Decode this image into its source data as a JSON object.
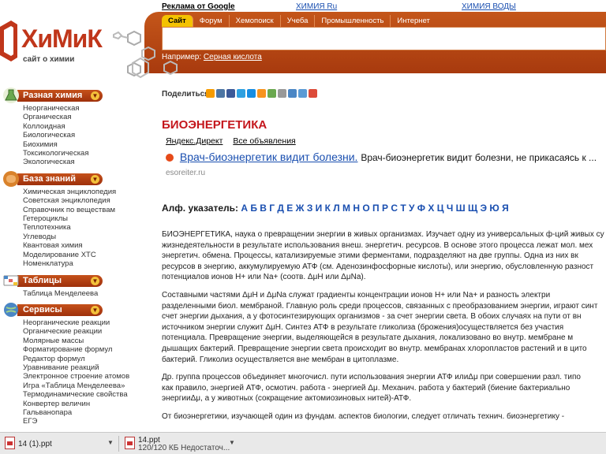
{
  "logo": {
    "name": "ХиМиК",
    "subtitle": "сайт о химии"
  },
  "ads_top": {
    "google": "Реклама от Google",
    "link1": "ХИМИЯ Ru",
    "link2": "ХИМИЯ ВОДЫ"
  },
  "nav": {
    "tabs": [
      "Сайт",
      "Форум",
      "Хемопоиск",
      "Учеба",
      "Промышленность",
      "Интернет"
    ],
    "search_value": "",
    "example_label": "Например:",
    "example_link": "Серная кислота"
  },
  "sidebar": {
    "sections": [
      {
        "title": "Разная химия",
        "icon": "flask-icon",
        "items": [
          "Неорганическая",
          "Органическая",
          "Коллоидная",
          "Биологическая",
          "Биохимия",
          "Токсикологическая",
          "Экологическая"
        ]
      },
      {
        "title": "База знаний",
        "icon": "brain-icon",
        "items": [
          "Химическая энциклопедия",
          "Советская энциклопедия",
          "Справочник по веществам",
          "Гетероциклы",
          "Теплотехника",
          "Углеводы",
          "Квантовая химия",
          "Моделирование ХТС",
          "Номенклатура"
        ]
      },
      {
        "title": "Таблицы",
        "icon": "table-icon",
        "items": [
          "Таблица Менделеева"
        ]
      },
      {
        "title": "Сервисы",
        "icon": "globe-icon",
        "items": [
          "Неорганические реакции",
          "Органические реакции",
          "Молярные массы",
          "Форматирование формул",
          "Редактор формул",
          "Уравнивание реакций",
          "Электронное строение атомов",
          "Игра «Таблица Менделеева»",
          "Термодинамические свойства",
          "Конвертер величин",
          "Гальванопара",
          "ЕГЭ"
        ]
      }
    ]
  },
  "main": {
    "share_label": "Поделиться:",
    "title": "БИОЭНЕРГЕТИКА",
    "yad": {
      "direct": "Яндекс.Директ",
      "all": "Все объявления"
    },
    "ad": {
      "title": "Врач-биоэнергетик видит болезни.",
      "desc": "Врач-биоэнергетик видит болезни, не прикасаясь к ...",
      "domain": "esoreiter.ru"
    },
    "alphabet_label": "Алф. указатель:",
    "alphabet": "А Б В Г Д Е Ж З И К Л М Н О П Р С Т У Ф Х Ц Ч Ш Щ Э Ю Я",
    "paragraphs": [
      "БИОЭНЕРГЕТИКА, наука о превращении энергии в живых организмах. Изучает одну из универсальных ф-ций живых су",
      "жизнедеятельности в результате использования внеш. энергетич. ресурсов. В основе этого процесса лежат мол. мех",
      "энергетич. обмена. Процессы, катализируемые этими ферментами, подразделяют на две группы. Одна из них вк",
      "ресурсов в энергию, аккумулируемую АТФ (см. Аденозинфосфорные кислоты), или энергию, обусловленную разност",
      "потенциалов ионов H+ или Na+ (соотв. ΔμH или ΔμNa).",
      "Составными частями ΔμH и ΔμNa служат градиенты концентрации ионов H+ или Na+ и разность электри",
      "разделенными биол. мембраной. Главную роль среди процессов, связанных с преобразованием энергии, играют синт",
      "счет энергии дыхания, а у фотосинтезирующих организмов - за счет энергии света. В обоих случаях на пути от вн",
      "источником энергии служит ΔμH. Синтез АТФ в результате гликолиза (брожения)осуществляется без участия",
      "потенциала. Превращение энергии, выделяющейся в результате дыхания, локализовано во внутр. мембране м",
      "дышащих бактерий. Превращение энергии света происходит во внутр. мембранах хлоропластов растений и в цито",
      "бактерий. Гликолиз осуществляется вне мембран в цитоплазме.",
      "Др. группа процессов объединяет многочисл. пути использования энергии АТФ илиΔμ при совершении разл. типо",
      "как правило, энергией АТФ, осмотич. работа - энергией Δμ. Механич. работа у бактерий (биение бактериально",
      "энергииΔμ, а у животных (сокращение актомиозиновых нитей)-АТФ.",
      "От биоэнергетики, изучающей один из фундам. аспектов биологии, следует отличать технич. биоэнергетику -"
    ]
  },
  "downloads": [
    {
      "name": "14 (1).ppt",
      "sub": ""
    },
    {
      "name": "14.ppt",
      "sub": "120/120 КБ Недостаточ..."
    }
  ],
  "colors": {
    "brand": "#c4561a",
    "accent": "#f4c200",
    "title": "#c4161c",
    "link": "#1a4fb0"
  }
}
